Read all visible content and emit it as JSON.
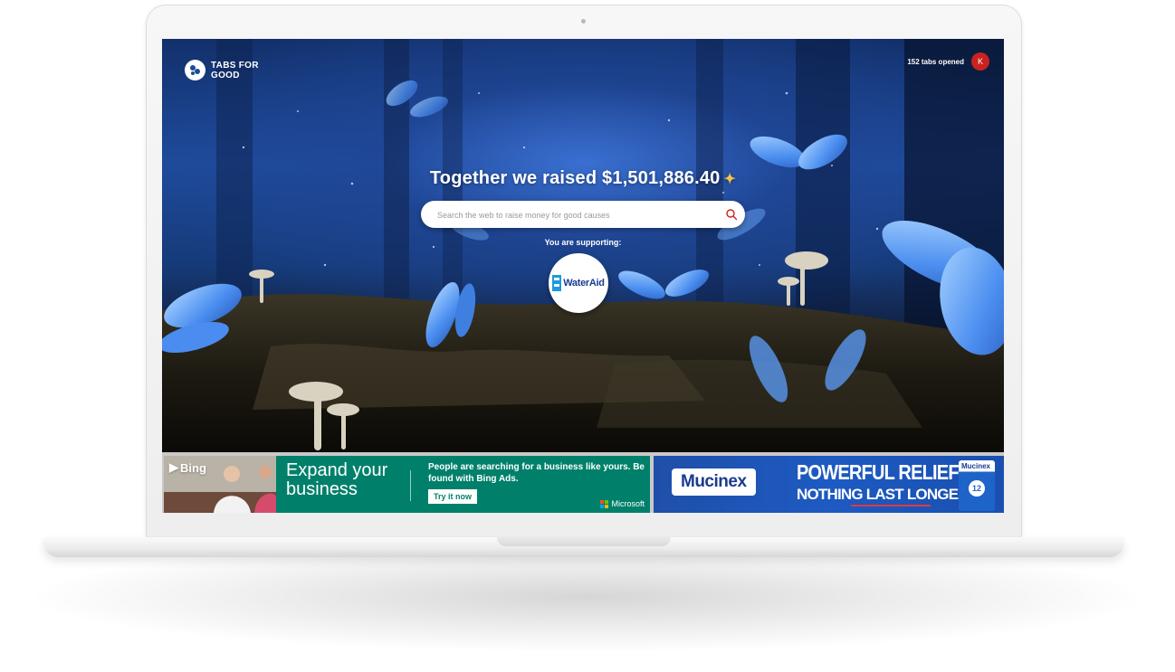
{
  "app": {
    "brand_name": "TABS FOR GOOD",
    "tabs_opened": "152 tabs opened",
    "avatar_initial": "K"
  },
  "hero": {
    "headline": "Together we raised $1,501,886.40",
    "search_placeholder": "Search the web to raise money for good causes",
    "supporting_label": "You are supporting:",
    "charity_name": "WaterAid"
  },
  "ads": {
    "bing": {
      "logo_text": "Bing",
      "headline": "Expand your business",
      "body": "People are searching for a business like yours. Be found with Bing Ads.",
      "cta": "Try it now",
      "advertiser": "Microsoft",
      "color": "#00806a"
    },
    "mucinex": {
      "logo_text": "Mucinex",
      "line1": "POWERFUL RELIEF",
      "line2": "NOTHING LAST LONGER",
      "box_label": "Mucinex",
      "box_badge": "12",
      "color": "#1d5ac2"
    }
  },
  "colors": {
    "avatar": "#c8231f",
    "sparkle": "#f3c14a",
    "hero_blue": "#1e4b9c"
  },
  "icons": [
    "tabs-for-good-logo-icon",
    "sparkle-icon",
    "search-icon",
    "wateraid-logo-icon",
    "bing-logo-icon",
    "microsoft-logo-icon"
  ]
}
